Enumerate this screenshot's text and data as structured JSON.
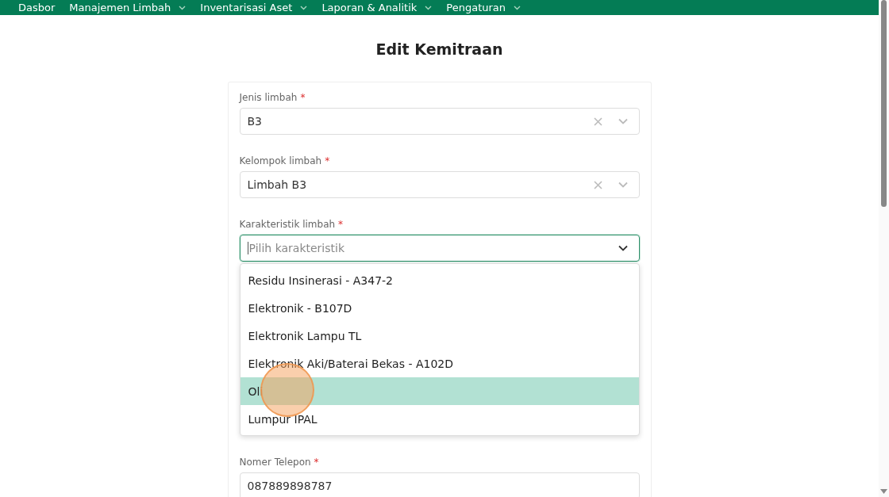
{
  "nav": [
    {
      "label": "Dasbor",
      "has_menu": false
    },
    {
      "label": "Manajemen Limbah",
      "has_menu": true
    },
    {
      "label": "Inventarisasi Aset",
      "has_menu": true
    },
    {
      "label": "Laporan & Analitik",
      "has_menu": true
    },
    {
      "label": "Pengaturan",
      "has_menu": true
    }
  ],
  "title": "Edit Kemitraan",
  "fields": [
    {
      "kind": "select",
      "label": "Jenis limbah",
      "required_mark": "*",
      "value": "B3",
      "clearable": true,
      "focused": false
    },
    {
      "kind": "select",
      "label": "Kelompok limbah",
      "required_mark": "*",
      "value": "Limbah B3",
      "clearable": true,
      "focused": false
    },
    {
      "kind": "select",
      "label": "Karakteristik limbah",
      "required_mark": "*",
      "placeholder": "Pilih karakteristik",
      "clearable": false,
      "focused": true,
      "options": [
        {
          "label": "Residu Insinerasi - A347-2",
          "selected": false
        },
        {
          "label": "Elektronik - B107D",
          "selected": false
        },
        {
          "label": "Elektronik Lampu TL",
          "selected": false
        },
        {
          "label": "Elektronik Aki/Baterai Bekas - A102D",
          "selected": false
        },
        {
          "label": "Oli",
          "selected": true
        },
        {
          "label": "Lumpur IPAL",
          "selected": false
        }
      ]
    },
    {
      "kind": "text",
      "label": "Nomer Telepon",
      "required_mark": "*",
      "value": "087889898787",
      "focused": false
    }
  ]
}
